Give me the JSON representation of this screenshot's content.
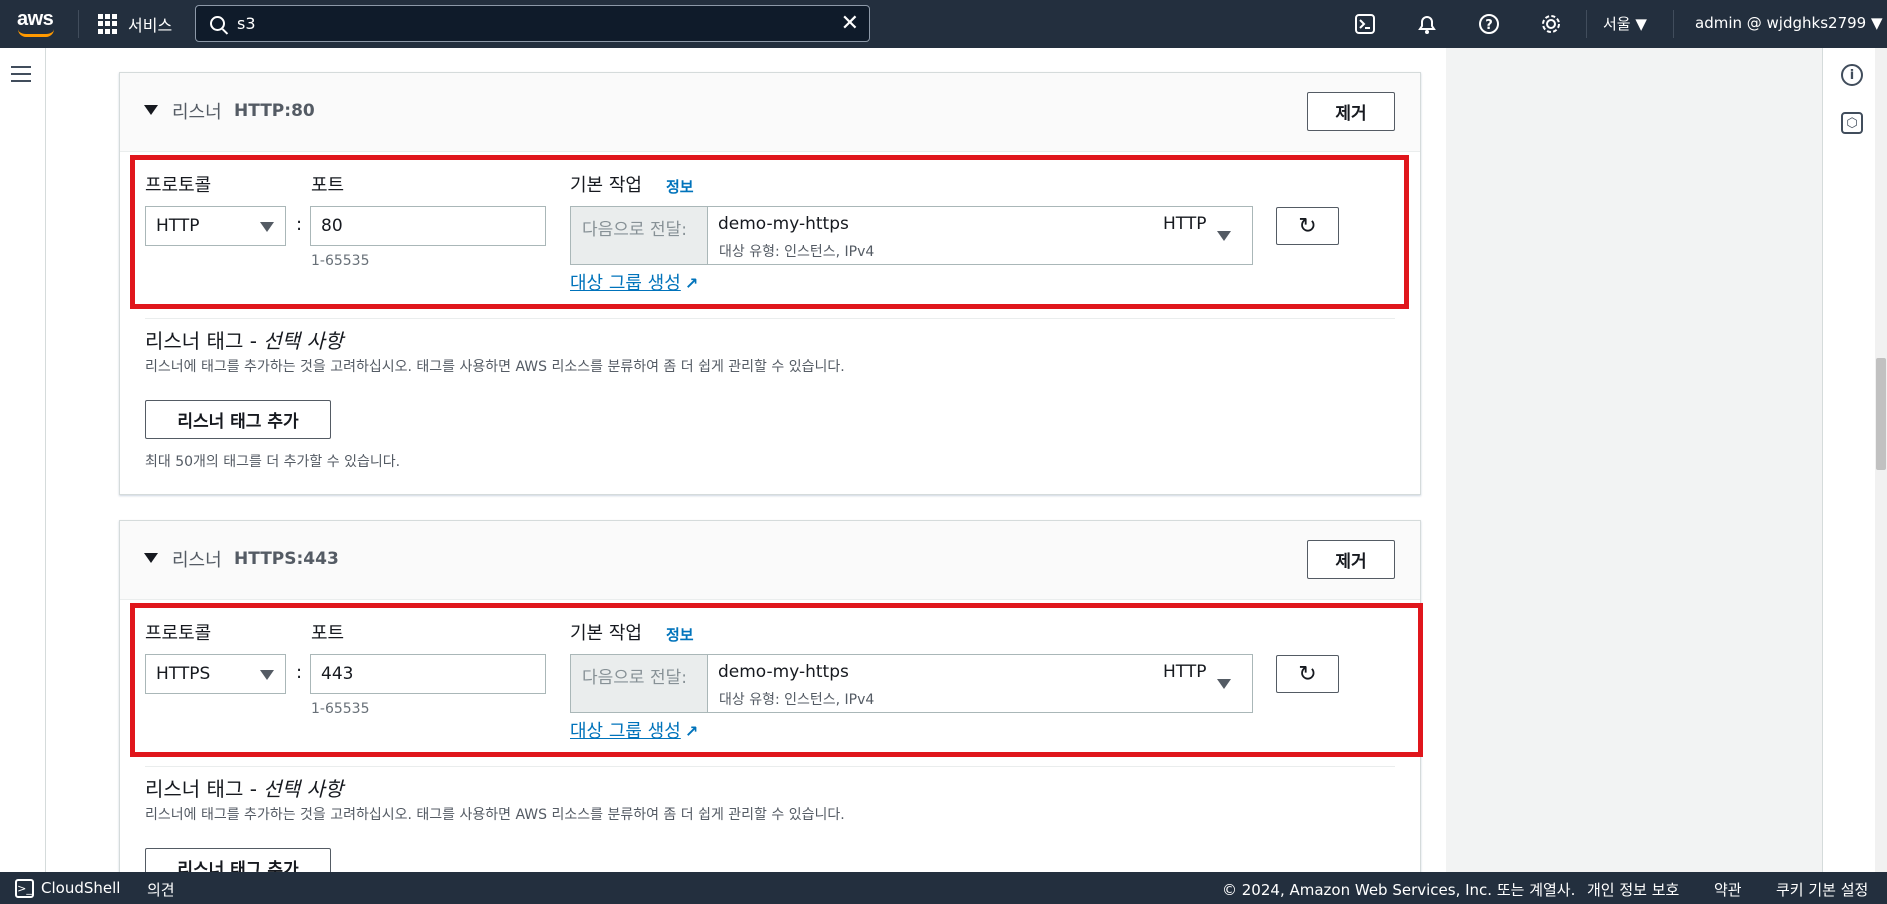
{
  "topnav": {
    "logo": "aws",
    "services_label": "서비스",
    "search_value": "s3",
    "region": "서울",
    "user": "admin @ wjdghks2799",
    "icons": [
      "cloudshell-icon",
      "bell-icon",
      "help-icon",
      "gear-icon"
    ]
  },
  "listeners": [
    {
      "title_label": "리스너",
      "title_value": "HTTP:80",
      "remove_label": "제거",
      "protocol_label": "프로토콜",
      "protocol_value": "HTTP",
      "port_label": "포트",
      "port_value": "80",
      "port_hint": "1-65535",
      "default_action_label": "기본 작업",
      "info_label": "정보",
      "forward_prefix": "다음으로 전달:",
      "target_name": "demo-my-https",
      "target_protocol": "HTTP",
      "target_sub": "대상 유형: 인스턴스, IPv4",
      "create_target_link": "대상 그룹 생성",
      "tag_title": "리스너 태그 - ",
      "tag_title_em": "선택 사항",
      "tag_desc": "리스너에 태그를 추가하는 것을 고려하십시오. 태그를 사용하면 AWS 리소스를 분류하여 좀 더 쉽게 관리할 수 있습니다.",
      "add_tag_button": "리스너 태그 추가",
      "tag_limit": "최대 50개의 태그를 더 추가할 수 있습니다."
    },
    {
      "title_label": "리스너",
      "title_value": "HTTPS:443",
      "remove_label": "제거",
      "protocol_label": "프로토콜",
      "protocol_value": "HTTPS",
      "port_label": "포트",
      "port_value": "443",
      "port_hint": "1-65535",
      "default_action_label": "기본 작업",
      "info_label": "정보",
      "forward_prefix": "다음으로 전달:",
      "target_name": "demo-my-https",
      "target_protocol": "HTTP",
      "target_sub": "대상 유형: 인스턴스, IPv4",
      "create_target_link": "대상 그룹 생성",
      "tag_title": "리스너 태그 - ",
      "tag_title_em": "선택 사항",
      "tag_desc": "리스너에 태그를 추가하는 것을 고려하십시오. 태그를 사용하면 AWS 리소스를 분류하여 좀 더 쉽게 관리할 수 있습니다.",
      "add_tag_button": "리스너 태그 추가"
    }
  ],
  "footer": {
    "cloudshell": "CloudShell",
    "feedback": "의견",
    "copyright": "© 2024, Amazon Web Services, Inc. 또는 계열사.",
    "privacy": "개인 정보 보호",
    "terms": "약관",
    "cookies": "쿠키 기본 설정"
  },
  "colors": {
    "nav_bg": "#232f3e",
    "highlight": "#e0161c",
    "link": "#0073bb"
  }
}
